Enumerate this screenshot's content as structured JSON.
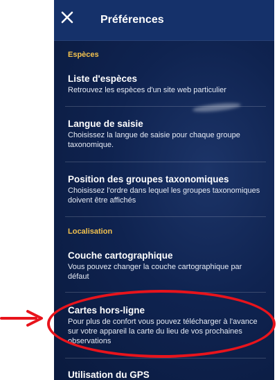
{
  "header": {
    "title": "Préférences"
  },
  "sections": [
    {
      "header": "Espèces",
      "items": [
        {
          "title": "Liste d'espèces",
          "description": "Retrouvez les espèces d'un site web particulier"
        },
        {
          "title": "Langue de saisie",
          "description": "Choisissez la langue de saisie pour chaque groupe taxonomique."
        },
        {
          "title": "Position des groupes taxonomiques",
          "description": "Choisissez l'ordre dans lequel les groupes taxonomiques doivent être affichés"
        }
      ]
    },
    {
      "header": "Localisation",
      "items": [
        {
          "title": "Couche cartographique",
          "description": "Vous pouvez changer la couche cartographique par défaut"
        },
        {
          "title": "Cartes hors-ligne",
          "description": "Pour plus de confort vous pouvez télécharger à l'avance sur votre appareil la carte du lieu de vos prochaines observations"
        },
        {
          "title": "Utilisation du GPS",
          "description": ""
        }
      ]
    }
  ],
  "colors": {
    "header_bg": "#15316a",
    "section_header": "#f2c14e",
    "annotation": "#e8141c"
  },
  "icons": {
    "close": "close-icon",
    "annotation_arrow": "arrow-right-icon"
  }
}
